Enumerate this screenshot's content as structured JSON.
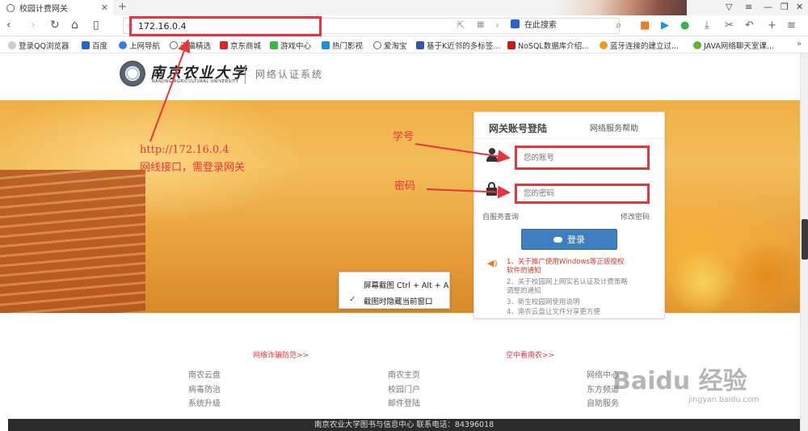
{
  "browser": {
    "tab_title": "校园计费网关",
    "tab_close": "✕",
    "new_tab": "+",
    "url": "172.16.0.4",
    "search_placeholder": "在此搜索",
    "bookmarks": [
      "登录QQ浏览器",
      "百度",
      "上网导航",
      "天猫精选",
      "京东商城",
      "游戏中心",
      "热门影视",
      "爱淘宝",
      "基于K近邻的多标签...",
      "NoSQL数据库介绍...",
      "蓝牙连接的建立过...",
      "JAVA网络聊天室课..."
    ]
  },
  "header": {
    "logo_cn": "南京农业大学",
    "logo_en": "NANJING AGRICULTURAL UNIVERSITY",
    "system_title": "网络认证系统"
  },
  "login": {
    "title": "网关账号登陆",
    "help": "网络服务帮助",
    "user_placeholder": "您的账号",
    "pwd_placeholder": "您的密码",
    "self_service": "自服务查询",
    "change_pwd": "修改密码",
    "submit": "登录",
    "notices": [
      "1、关于推广使用Windows等正版授权软件的通知",
      "2、关于校园网上网实名认证及计费策略调整的通知",
      "3、新生校园网使用说明",
      "4、南农云盘让文件分享更方便"
    ]
  },
  "annotations": {
    "url_line": "http://172.16.0.4",
    "url_desc": "网线接口，需登录网关",
    "xuehao": "学号",
    "mima": "密码"
  },
  "screenshot_menu": {
    "item1": "屏幕截图 Ctrl + Alt + A",
    "item2": "截图时隐藏当前窗口",
    "check": "✓"
  },
  "links": {
    "head1": "网络诈骗防范>>",
    "head2": "空中看南农>>",
    "col1": [
      "南农云盘",
      "病毒防治",
      "系统升级"
    ],
    "col2": [
      "南农主页",
      "校园门户",
      "邮件登陆"
    ],
    "col3": [
      "网络中心",
      "东方频道",
      "自助服务"
    ]
  },
  "footer": "南京农业大学图书与信息中心 联系电话：84396018",
  "watermark": {
    "brand": "Baidu 经验",
    "url": "jingyan.baidu.com"
  }
}
